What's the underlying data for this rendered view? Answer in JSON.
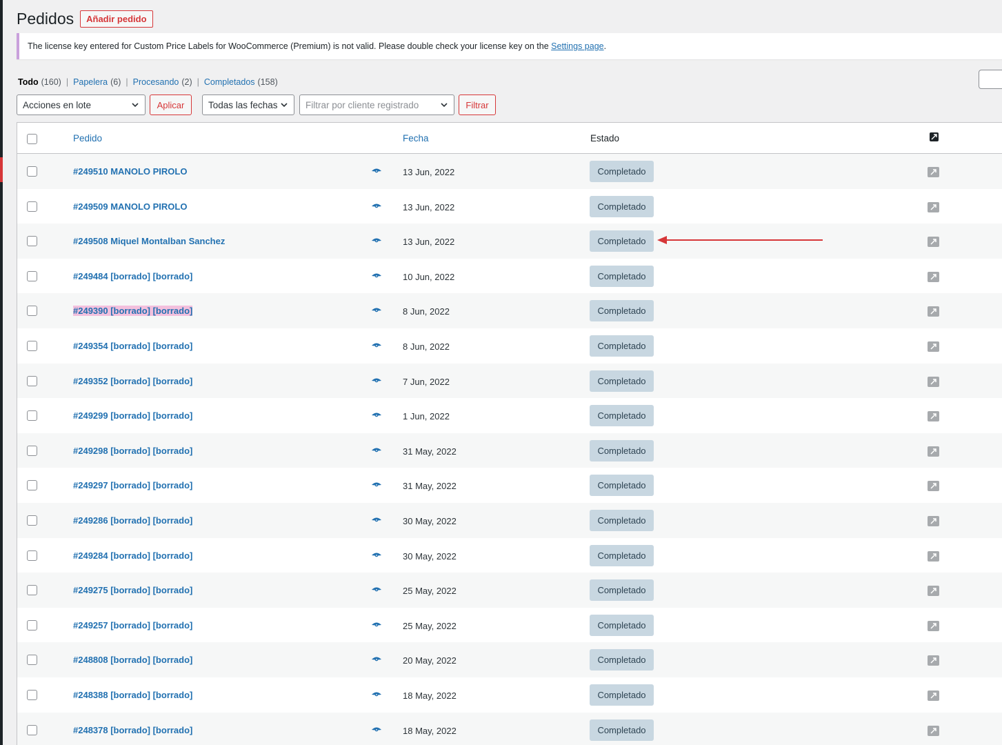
{
  "page": {
    "title": "Pedidos",
    "add_label": "Añadir pedido"
  },
  "notice": {
    "text_before": "The license key entered for Custom Price Labels for WooCommerce (Premium) is not valid. Please double check your license key on the",
    "link_text": "Settings page",
    "text_after": "."
  },
  "views": [
    {
      "label": "Todo",
      "count": "(160)",
      "current": true
    },
    {
      "label": "Papelera",
      "count": "(6)",
      "current": false
    },
    {
      "label": "Procesando",
      "count": "(2)",
      "current": false
    },
    {
      "label": "Completados",
      "count": "(158)",
      "current": false
    }
  ],
  "tablenav": {
    "bulk_actions": "Acciones en lote",
    "apply": "Aplicar",
    "dates": "Todas las fechas",
    "customer_placeholder": "Filtrar por cliente registrado",
    "filter": "Filtrar"
  },
  "columns": {
    "order": "Pedido",
    "date": "Fecha",
    "status": "Estado"
  },
  "orders": [
    {
      "label": "#249510 MANOLO PIROLO",
      "date": "13 Jun, 2022",
      "status": "Completado"
    },
    {
      "label": "#249509 MANOLO PIROLO",
      "date": "13 Jun, 2022",
      "status": "Completado"
    },
    {
      "label": "#249508 Miquel Montalban Sanchez",
      "date": "13 Jun, 2022",
      "status": "Completado"
    },
    {
      "label": "#249484 [borrado] [borrado]",
      "date": "10 Jun, 2022",
      "status": "Completado"
    },
    {
      "label": "#249390 [borrado] [borrado]",
      "date": "8 Jun, 2022",
      "status": "Completado",
      "highlight": true
    },
    {
      "label": "#249354 [borrado] [borrado]",
      "date": "8 Jun, 2022",
      "status": "Completado"
    },
    {
      "label": "#249352 [borrado] [borrado]",
      "date": "7 Jun, 2022",
      "status": "Completado"
    },
    {
      "label": "#249299 [borrado] [borrado]",
      "date": "1 Jun, 2022",
      "status": "Completado"
    },
    {
      "label": "#249298 [borrado] [borrado]",
      "date": "31 May, 2022",
      "status": "Completado"
    },
    {
      "label": "#249297 [borrado] [borrado]",
      "date": "31 May, 2022",
      "status": "Completado"
    },
    {
      "label": "#249286 [borrado] [borrado]",
      "date": "30 May, 2022",
      "status": "Completado"
    },
    {
      "label": "#249284 [borrado] [borrado]",
      "date": "30 May, 2022",
      "status": "Completado"
    },
    {
      "label": "#249275 [borrado] [borrado]",
      "date": "25 May, 2022",
      "status": "Completado"
    },
    {
      "label": "#249257 [borrado] [borrado]",
      "date": "25 May, 2022",
      "status": "Completado"
    },
    {
      "label": "#248808 [borrado] [borrado]",
      "date": "20 May, 2022",
      "status": "Completado"
    },
    {
      "label": "#248388 [borrado] [borrado]",
      "date": "18 May, 2022",
      "status": "Completado"
    },
    {
      "label": "#248378 [borrado] [borrado]",
      "date": "18 May, 2022",
      "status": "Completado"
    }
  ],
  "icons": {
    "preview": "eye-icon",
    "action": "external-link-icon",
    "annotation": "red-arrow"
  },
  "colors": {
    "link": "#2271b1",
    "danger": "#d63638",
    "status_completed_bg": "#c8d7e1",
    "status_completed_text": "#2e4453",
    "highlight": "#f3c0dd"
  }
}
